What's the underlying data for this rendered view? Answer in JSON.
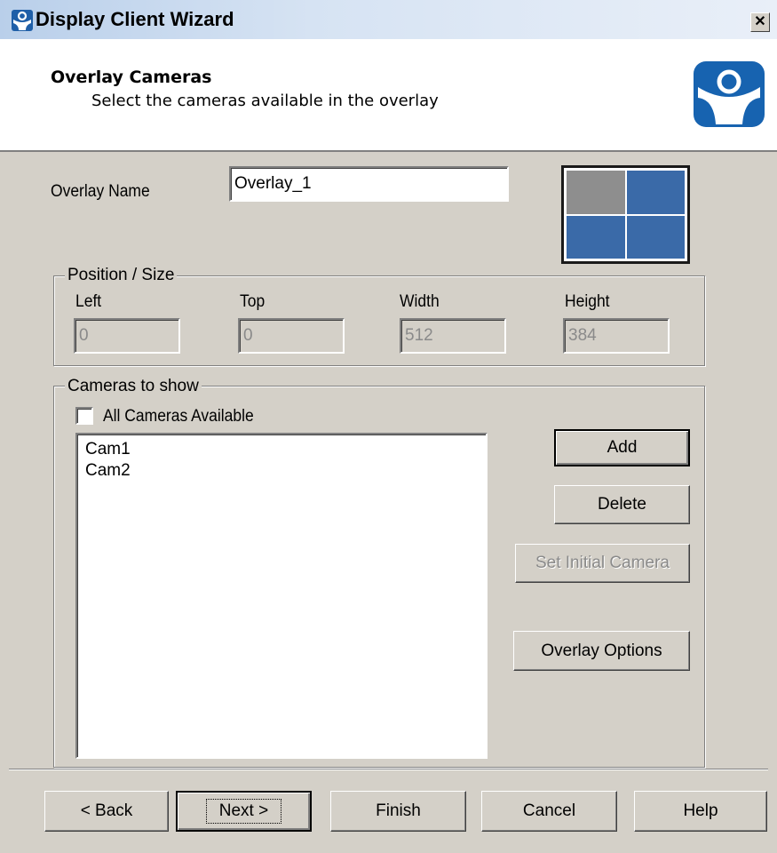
{
  "window": {
    "title": "Display Client Wizard",
    "close_glyph": "✕"
  },
  "header": {
    "title": "Overlay Cameras",
    "subtitle": "Select the cameras available in the overlay",
    "logo_icon": "terminal-server-person-logo-icon"
  },
  "overlay": {
    "name_label": "Overlay Name",
    "name_value": "Overlay_1",
    "preview_cells": [
      "selected",
      "blue",
      "blue",
      "blue"
    ]
  },
  "position_size": {
    "legend": "Position / Size",
    "left_label": "Left",
    "left_value": "0",
    "top_label": "Top",
    "top_value": "0",
    "width_label": "Width",
    "width_value": "512",
    "height_label": "Height",
    "height_value": "384"
  },
  "cameras": {
    "legend": "Cameras to show",
    "all_available_label": "All Cameras Available",
    "all_available_checked": false,
    "list": [
      "Cam1",
      "Cam2"
    ],
    "add_label": "Add",
    "delete_label": "Delete",
    "set_initial_label": "Set Initial Camera"
  },
  "overlay_options_label": "Overlay Options",
  "footer": {
    "back_label": "< Back",
    "next_label": "Next >",
    "finish_label": "Finish",
    "cancel_label": "Cancel",
    "help_label": "Help"
  },
  "colors": {
    "dialog_bg": "#d4d0c8",
    "preview_blue": "#3a6aa8",
    "preview_selected": "#8e8e8e"
  }
}
